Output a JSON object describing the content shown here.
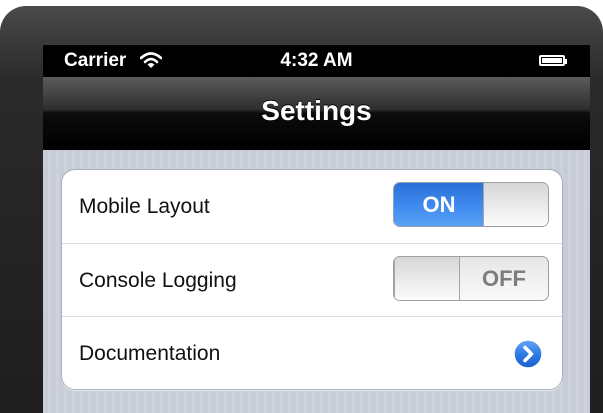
{
  "status_bar": {
    "carrier": "Carrier",
    "time": "4:32 AM",
    "wifi_icon": "wifi-icon",
    "battery_icon": "battery-icon"
  },
  "nav": {
    "title": "Settings"
  },
  "settings": {
    "rows": [
      {
        "label": "Mobile Layout",
        "control": "toggle",
        "state": "ON"
      },
      {
        "label": "Console Logging",
        "control": "toggle",
        "state": "OFF"
      },
      {
        "label": "Documentation",
        "control": "disclosure",
        "icon": "chevron-right-icon"
      }
    ]
  },
  "colors": {
    "toggle_on": "#3f8bf0",
    "nav_bar": "#000000",
    "background": "#c7ccd6"
  }
}
